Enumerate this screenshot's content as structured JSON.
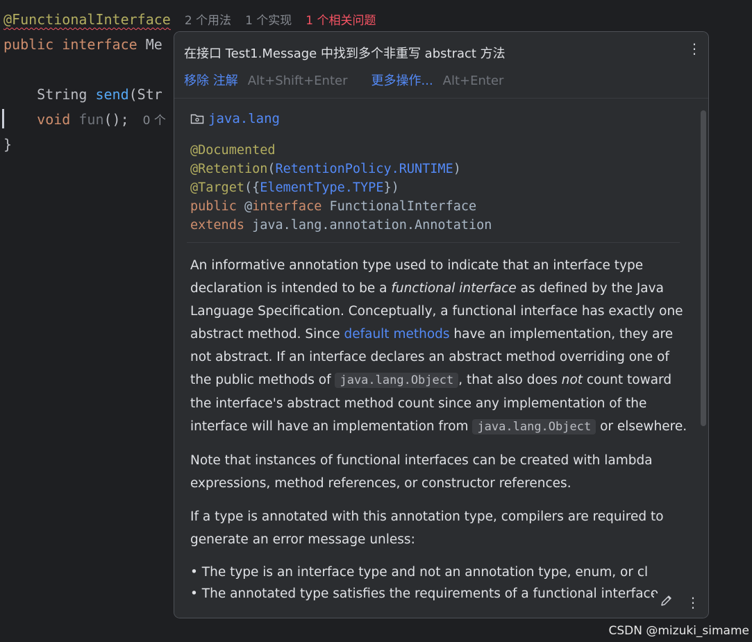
{
  "editor": {
    "annotation": "@FunctionalInterface",
    "inlay_usages": "2 个用法",
    "inlay_impl": "1 个实现",
    "inlay_problem": "1 个相关问题",
    "line2_kw1": "public",
    "line2_kw2": "interface",
    "line2_name": "Me",
    "line3_type": "String",
    "line3_method": "send",
    "line3_rest": "(Str",
    "line4_kw": "void",
    "line4_method": "fun",
    "line4_rest": "();",
    "line4_inlay": "0 个",
    "line5_brace": "}"
  },
  "popup": {
    "problem_title": "在接口 Test1.Message 中找到多个非重写 abstract 方法",
    "action_remove": "移除 注解",
    "action_remove_shortcut": "Alt+Shift+Enter",
    "action_more": "更多操作...",
    "action_more_shortcut": "Alt+Enter",
    "header_menu_icon": "vertical-ellipsis-icon"
  },
  "doc": {
    "package": "java.lang",
    "package_icon": "package-folder-icon",
    "sig": {
      "a1": "@Documented",
      "a2_name": "@Retention",
      "a2_open": "(",
      "a2_value": "RetentionPolicy.RUNTIME",
      "a2_close": ")",
      "a3_name": "@Target",
      "a3_open": "({",
      "a3_value": "ElementType.TYPE",
      "a3_close": "})",
      "l4_kw": "public",
      "l4_at": "@",
      "l4_kw2": "interface",
      "l4_name": "FunctionalInterface",
      "l5_kw": "extends",
      "l5_name": "java.lang.annotation.Annotation"
    },
    "p1": {
      "t1": "An informative annotation type used to indicate that an interface type declaration is intended to be a ",
      "em1": "functional interface",
      "t2": " as defined by the Java Language Specification. Conceptually, a functional interface has exactly one abstract method. Since ",
      "link": "default methods",
      "t3": " have an implementation, they are not abstract. If an interface declares an abstract method overriding one of the public methods of ",
      "code1": "java.lang.Object",
      "t4": ", that also does ",
      "em2": "not",
      "t5": " count toward the interface's abstract method count since any implementation of the interface will have an implementation from ",
      "code2": "java.lang.Object",
      "t6": " or elsewhere."
    },
    "p2": "Note that instances of functional interfaces can be created with lambda expressions, method references, or constructor references.",
    "p3": "If a type is annotated with this annotation type, compilers are required to generate an error message unless:",
    "bullets": [
      "• The type is an interface type and not an annotation type, enum, or cl",
      "• The annotated type satisfies the requirements of a functional interface."
    ],
    "edit_icon": "pencil-edit-icon",
    "more_icon": "vertical-ellipsis-icon"
  },
  "watermark": "CSDN @mizuki_simame"
}
